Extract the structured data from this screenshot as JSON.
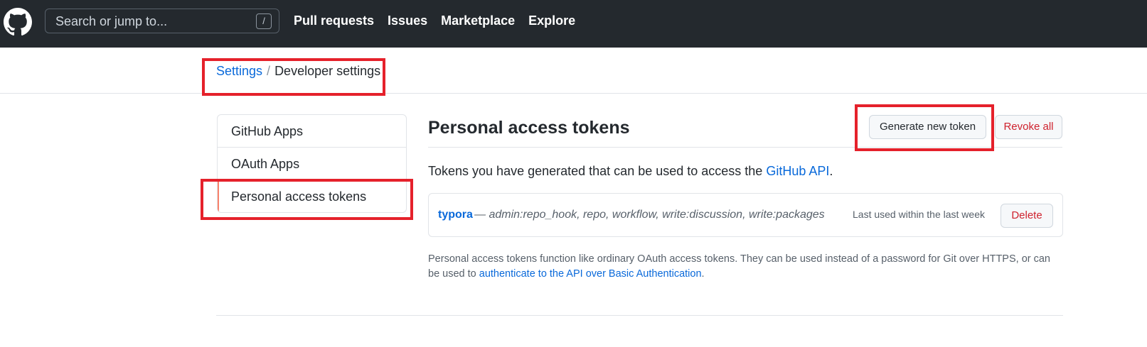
{
  "header": {
    "search_placeholder": "Search or jump to...",
    "search_shortcut": "/",
    "nav": [
      "Pull requests",
      "Issues",
      "Marketplace",
      "Explore"
    ]
  },
  "breadcrumb": {
    "parent": "Settings",
    "separator": "/",
    "current": "Developer settings"
  },
  "sidebar": {
    "items": [
      "GitHub Apps",
      "OAuth Apps",
      "Personal access tokens"
    ],
    "selected": "Personal access tokens"
  },
  "main": {
    "title": "Personal access tokens",
    "generate_label": "Generate new token",
    "revoke_label": "Revoke all",
    "intro_text": "Tokens you have generated that can be used to access the ",
    "intro_link": "GitHub API",
    "intro_end": ".",
    "token": {
      "name": "typora",
      "scopes": "— admin:repo_hook, repo, workflow, write:discussion, write:packages",
      "last_used": "Last used within the last week",
      "delete_label": "Delete"
    },
    "footnote_text": "Personal access tokens function like ordinary OAuth access tokens. They can be used instead of a password for Git over HTTPS, or can be used to ",
    "footnote_link": "authenticate to the API over Basic Authentication",
    "footnote_end": "."
  },
  "colors": {
    "header_bg": "#24292e",
    "link": "#0969da",
    "danger": "#cf222e",
    "annotation": "#e5212b",
    "selected_marker": "#f9826c"
  }
}
